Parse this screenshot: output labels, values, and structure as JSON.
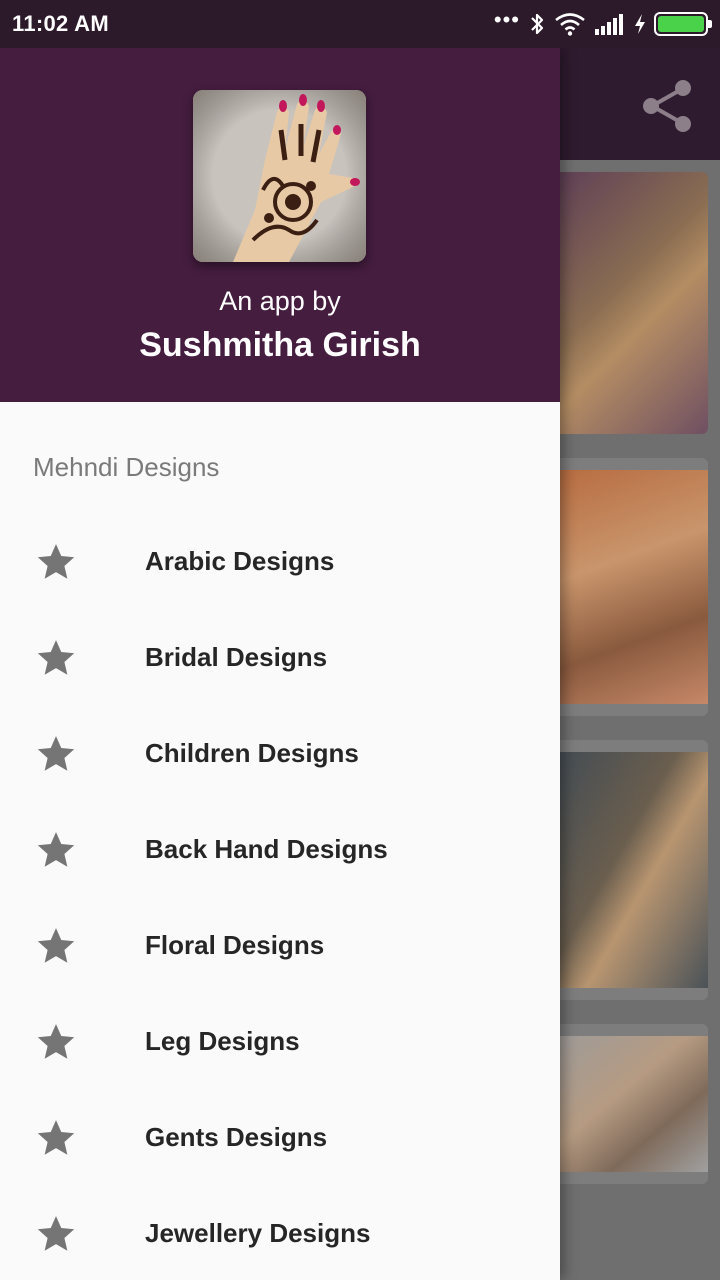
{
  "status_bar": {
    "time": "11:02 AM",
    "more_dots": "•••",
    "battery_level": 1.0,
    "icons": [
      "bluetooth-icon",
      "wifi-icon",
      "signal-icon",
      "charging-icon",
      "battery-icon"
    ]
  },
  "app_bar": {
    "share_icon": "share-icon"
  },
  "drawer": {
    "byline": "An app by",
    "author": "Sushmitha Girish",
    "section_title": "Mehndi Designs",
    "items": [
      {
        "label": "Arabic Designs",
        "icon": "star-icon"
      },
      {
        "label": "Bridal Designs",
        "icon": "star-icon"
      },
      {
        "label": "Children Designs",
        "icon": "star-icon"
      },
      {
        "label": "Back Hand Designs",
        "icon": "star-icon"
      },
      {
        "label": "Floral Designs",
        "icon": "star-icon"
      },
      {
        "label": "Leg Designs",
        "icon": "star-icon"
      },
      {
        "label": "Gents Designs",
        "icon": "star-icon"
      },
      {
        "label": "Jewellery Designs",
        "icon": "star-icon"
      }
    ]
  },
  "colors": {
    "header": "#451d3f",
    "app_bar": "#2f1b2f",
    "status_bar": "#2c1a2a",
    "drawer_bg": "#fafafa",
    "star": "#757575",
    "battery": "#4ad34a"
  }
}
